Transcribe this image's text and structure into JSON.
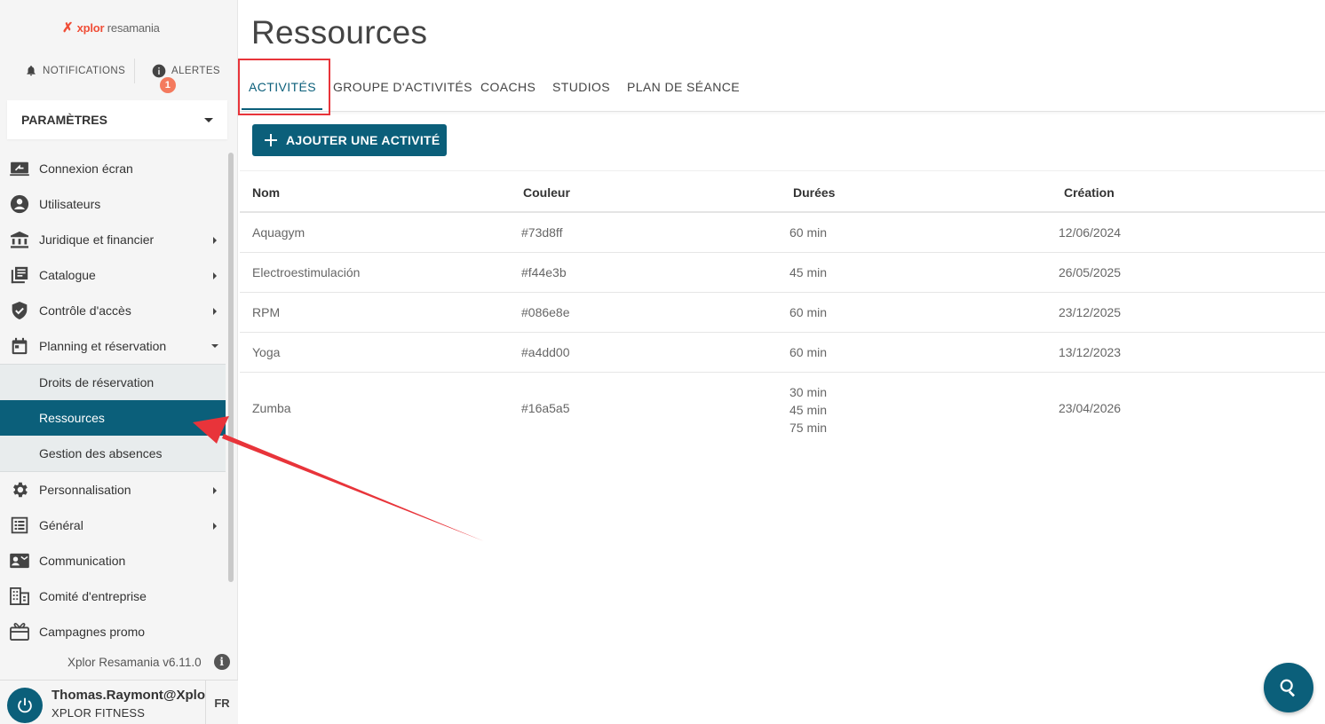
{
  "brand": {
    "logo_mark": "✗",
    "logo_bold": "xplor",
    "logo_rest": " resamania"
  },
  "topbar": {
    "notifications_label": "NOTIFICATIONS",
    "alerts_label": "ALERTES",
    "alerts_count": "1"
  },
  "sidebar": {
    "section_label": "PARAMÈTRES",
    "items": [
      {
        "label": "Connexion écran",
        "icon": "screen-share-icon"
      },
      {
        "label": "Utilisateurs",
        "icon": "account-circle-icon"
      },
      {
        "label": "Juridique et financier",
        "icon": "bank-icon"
      },
      {
        "label": "Catalogue",
        "icon": "catalog-icon"
      },
      {
        "label": "Contrôle d'accès",
        "icon": "shield-check-icon"
      },
      {
        "label": "Planning et réservation",
        "icon": "calendar-icon"
      }
    ],
    "sub_items": [
      {
        "label": "Droits de réservation"
      },
      {
        "label": "Ressources"
      },
      {
        "label": "Gestion des absences"
      }
    ],
    "items_after": [
      {
        "label": "Personnalisation",
        "icon": "gear-icon"
      },
      {
        "label": "Général",
        "icon": "list-icon"
      },
      {
        "label": "Communication",
        "icon": "contact-mail-icon"
      },
      {
        "label": "Comité d'entreprise",
        "icon": "building-icon"
      },
      {
        "label": "Campagnes promo",
        "icon": "gift-card-icon"
      }
    ],
    "version": "Xplor Resamania v6.11.0"
  },
  "user": {
    "name": "Thomas.Raymont@Xplor",
    "org": "XPLOR FITNESS",
    "lang": "FR"
  },
  "main": {
    "title": "Ressources",
    "tabs": [
      {
        "label": "ACTIVITÉS",
        "active": true
      },
      {
        "label": "GROUPE D'ACTIVITÉS"
      },
      {
        "label": "COACHS"
      },
      {
        "label": "STUDIOS"
      },
      {
        "label": "PLAN DE SÉANCE"
      }
    ],
    "add_button": "AJOUTER UNE ACTIVITÉ",
    "table": {
      "headers": [
        "Nom",
        "Couleur",
        "Durées",
        "Création"
      ],
      "rows": [
        {
          "nom": "Aquagym",
          "couleur": "#73d8ff",
          "durees": [
            "60 min"
          ],
          "creation": "12/06/2024"
        },
        {
          "nom": "Electroestimulación",
          "couleur": "#f44e3b",
          "durees": [
            "45 min"
          ],
          "creation": "26/05/2025"
        },
        {
          "nom": "RPM",
          "couleur": "#086e8e",
          "durees": [
            "60 min"
          ],
          "creation": "23/12/2025"
        },
        {
          "nom": "Yoga",
          "couleur": "#a4dd00",
          "durees": [
            "60 min"
          ],
          "creation": "13/12/2023"
        },
        {
          "nom": "Zumba",
          "couleur": "#16a5a5",
          "durees": [
            "30 min",
            "45 min",
            "75 min"
          ],
          "creation": "23/04/2026"
        }
      ]
    }
  },
  "colors": {
    "accent": "#0b5f7a",
    "annotation": "#e8343a",
    "badge": "#f47a5e"
  }
}
